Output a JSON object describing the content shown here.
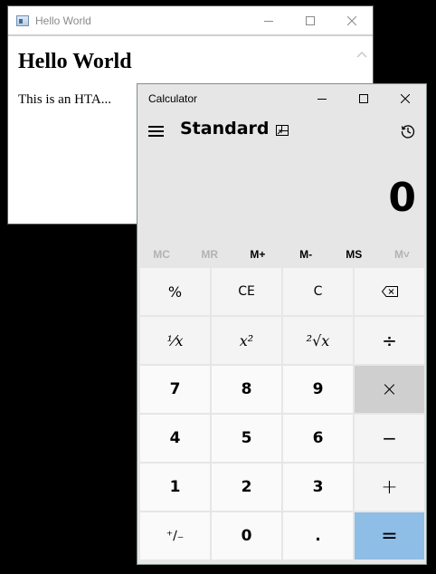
{
  "hta": {
    "title": "Hello World",
    "heading": "Hello World",
    "body_text": "This is an HTA..."
  },
  "calculator": {
    "window_title": "Calculator",
    "mode": "Standard",
    "display": "0",
    "memory": [
      {
        "label": "MC",
        "enabled": false
      },
      {
        "label": "MR",
        "enabled": false
      },
      {
        "label": "M+",
        "enabled": true
      },
      {
        "label": "M-",
        "enabled": true
      },
      {
        "label": "MS",
        "enabled": true
      },
      {
        "label": "M˅",
        "enabled": false
      }
    ],
    "keys": {
      "percent": "%",
      "ce": "CE",
      "clear": "C",
      "backspace": "⌫",
      "reciprocal": "⅟x",
      "square": "x²",
      "sqrt": "²√x",
      "divide": "÷",
      "seven": "7",
      "eight": "8",
      "nine": "9",
      "multiply": "×",
      "four": "4",
      "five": "5",
      "six": "6",
      "minus": "−",
      "one": "1",
      "two": "2",
      "three": "3",
      "plus": "+",
      "negate": "⁺∕₋",
      "zero": "0",
      "decimal": ".",
      "equals": "="
    },
    "colors": {
      "equals": "#8ebde6",
      "hover": "#cfcfcf",
      "background": "#e6e6e6"
    }
  }
}
